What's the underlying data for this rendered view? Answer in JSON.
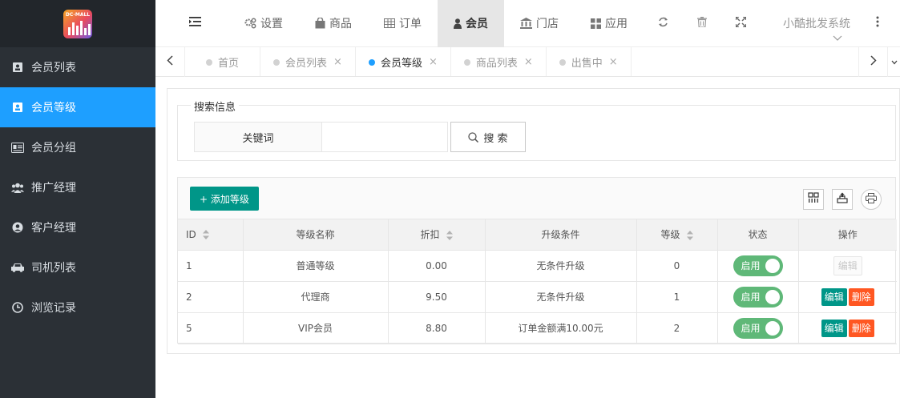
{
  "sidebar": {
    "logo_text": "DC-MALL",
    "items": [
      {
        "label": "会员列表",
        "icon": "contact-card-icon"
      },
      {
        "label": "会员等级",
        "icon": "contact-card-icon"
      },
      {
        "label": "会员分组",
        "icon": "id-card-icon"
      },
      {
        "label": "推广经理",
        "icon": "users-icon"
      },
      {
        "label": "客户经理",
        "icon": "user-circle-icon"
      },
      {
        "label": "司机列表",
        "icon": "car-icon"
      },
      {
        "label": "浏览记录",
        "icon": "clock-icon"
      }
    ],
    "active_index": 1
  },
  "topnav": {
    "items": [
      {
        "label": "设置",
        "icon": "gears-icon"
      },
      {
        "label": "商品",
        "icon": "shopping-bag-icon"
      },
      {
        "label": "订单",
        "icon": "table-icon"
      },
      {
        "label": "会员",
        "icon": "user-icon"
      },
      {
        "label": "门店",
        "icon": "bank-icon"
      },
      {
        "label": "应用",
        "icon": "grid-icon"
      }
    ],
    "active_label": "会员",
    "system_name": "小酷批发系统"
  },
  "page_tabs": [
    {
      "label": "首页",
      "closable": false
    },
    {
      "label": "会员列表",
      "closable": true
    },
    {
      "label": "会员等级",
      "closable": true,
      "active": true
    },
    {
      "label": "商品列表",
      "closable": true
    },
    {
      "label": "出售中",
      "closable": true
    }
  ],
  "search": {
    "legend": "搜索信息",
    "keyword_label": "关键词",
    "keyword_value": "",
    "button_label": "搜 索"
  },
  "toolbar": {
    "add_label": "+ 添加等级"
  },
  "table": {
    "headers": [
      "ID",
      "等级名称",
      "折扣",
      "升级条件",
      "等级",
      "状态",
      "操作"
    ],
    "rows": [
      {
        "id": "1",
        "name": "普通等级",
        "discount": "0.00",
        "condition": "无条件升级",
        "level": "0",
        "status": "启用",
        "edit_disabled": true
      },
      {
        "id": "2",
        "name": "代理商",
        "discount": "9.50",
        "condition": "无条件升级",
        "level": "1",
        "status": "启用",
        "edit_disabled": false
      },
      {
        "id": "5",
        "name": "VIP会员",
        "discount": "8.80",
        "condition": "订单金额满10.00元",
        "level": "2",
        "status": "启用",
        "edit_disabled": false
      }
    ],
    "edit_label": "编辑",
    "delete_label": "删除"
  },
  "colors": {
    "sidebar_bg": "#2b3036",
    "active_blue": "#1e9fff",
    "teal": "#009688",
    "danger": "#ff5722",
    "toggle_green": "#5fb878"
  }
}
